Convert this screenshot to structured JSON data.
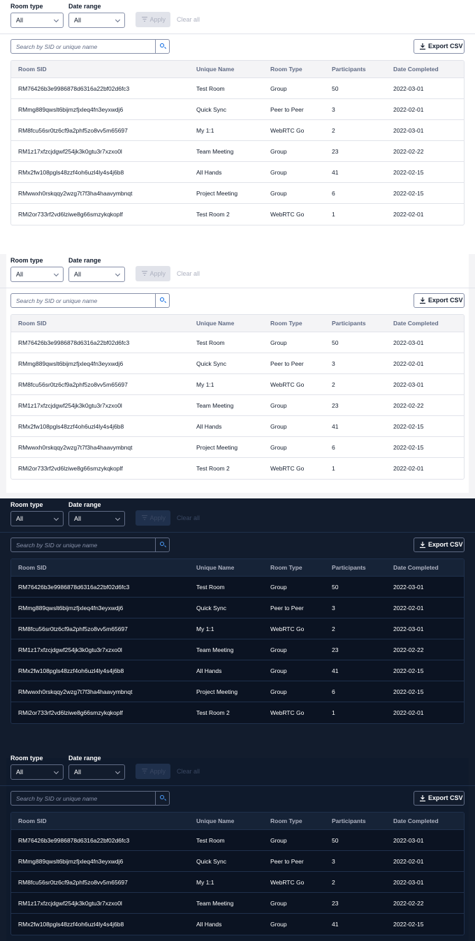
{
  "filters": {
    "room_type": {
      "label": "Room type",
      "value": "All"
    },
    "date_range": {
      "label": "Date range",
      "value": "All"
    },
    "apply_label": "Apply",
    "clear_label": "Clear all"
  },
  "search": {
    "placeholder": "Search by SID or unique name"
  },
  "export_label": "Export CSV",
  "table": {
    "columns": [
      "Room SID",
      "Unique Name",
      "Room Type",
      "Participants",
      "Date Completed"
    ],
    "rows": [
      [
        "RM76426b3e9986878d6316a22bf02d6fc3",
        "Test Room",
        "Group",
        "50",
        "2022-03-01"
      ],
      [
        "RMmg889qwslt6bijmzfjxleq4fn3eyxwdj6",
        "Quick Sync",
        "Peer to Peer",
        "3",
        "2022-02-01"
      ],
      [
        "RM8fcu56sr0tz6cf9a2phf5zo8vv5m65697",
        "My 1:1",
        "WebRTC Go",
        "2",
        "2022-03-01"
      ],
      [
        "RM1z17xfzcjdgwf254jk3k0gtu3r7xzxo0l",
        "Team Meeting",
        "Group",
        "23",
        "2022-02-22"
      ],
      [
        "RMx2fw108pgls48zzf4oh6uzl4ly4s4j6b8",
        "All Hands",
        "Group",
        "41",
        "2022-02-15"
      ],
      [
        "RMwwxh0rskqqy2wzg7t7f3ha4haavymbnqt",
        "Project Meeting",
        "Group",
        "6",
        "2022-02-15"
      ],
      [
        "RMi2or733rf2vd6lziwe8g66smzykqkoplf",
        "Test Room 2",
        "WebRTC Go",
        "1",
        "2022-02-01"
      ]
    ]
  },
  "themes": {
    "light_bg": "#ffffff",
    "light_alt_bg": "#f4f4f6",
    "dark_bg": "#121c2d",
    "accent": "#0263e0"
  },
  "icons": {
    "filter": "filter-icon",
    "search": "search-icon",
    "download": "download-icon",
    "chevron": "chevron-down-icon"
  }
}
